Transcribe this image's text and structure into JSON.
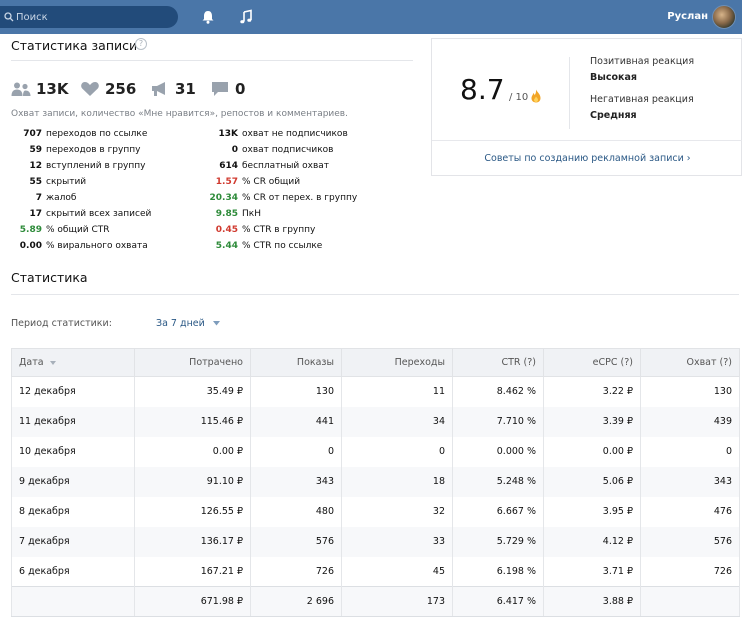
{
  "header": {
    "search_placeholder": "Поиск",
    "user_name": "Руслан"
  },
  "post_stats": {
    "title": "Статистика записи",
    "help": "?",
    "metrics": [
      {
        "icon": "users-icon",
        "value": "13K"
      },
      {
        "icon": "heart-icon",
        "value": "256"
      },
      {
        "icon": "megaphone-icon",
        "value": "31"
      },
      {
        "icon": "comment-icon",
        "value": "0"
      }
    ],
    "reach_note": "Охват записи, количество «Мне нравится», репостов и комментариев.",
    "left_stats": [
      {
        "value": "707",
        "label": "переходов по ссылке",
        "color": "normal"
      },
      {
        "value": "59",
        "label": "переходов в группу",
        "color": "normal"
      },
      {
        "value": "12",
        "label": "вступлений в группу",
        "color": "normal"
      },
      {
        "value": "55",
        "label": "скрытий",
        "color": "normal"
      },
      {
        "value": "7",
        "label": "жалоб",
        "color": "normal"
      },
      {
        "value": "17",
        "label": "скрытий всех записей",
        "color": "normal"
      },
      {
        "value": "5.89",
        "label": "% общий CTR",
        "color": "green"
      },
      {
        "value": "0.00",
        "label": "% вирального охвата",
        "color": "normal"
      }
    ],
    "right_stats": [
      {
        "value": "13K",
        "label": "охват не подписчиков",
        "color": "normal"
      },
      {
        "value": "0",
        "label": "охват подписчиков",
        "color": "normal"
      },
      {
        "value": "614",
        "label": "бесплатный охват",
        "color": "normal"
      },
      {
        "value": "1.57",
        "label": "% CR общий",
        "color": "red"
      },
      {
        "value": "20.34",
        "label": "% CR от перех. в группу",
        "color": "green"
      },
      {
        "value": "9.85",
        "label": "ПкН",
        "color": "green"
      },
      {
        "value": "0.45",
        "label": "% CTR в группу",
        "color": "red"
      },
      {
        "value": "5.44",
        "label": "% CTR по ссылке",
        "color": "green"
      }
    ]
  },
  "rating_card": {
    "score": "8.7",
    "score_denominator": "/ 10",
    "positive_label": "Позитивная реакция",
    "positive_value": "Высокая",
    "negative_label": "Негативная реакция",
    "negative_value": "Средняя",
    "advice_link": "Советы по созданию рекламной записи ›"
  },
  "statistics": {
    "title": "Статистика",
    "period_label": "Период статистики:",
    "period_value": "За 7 дней",
    "columns": [
      "Дата",
      "Потрачено",
      "Показы",
      "Переходы",
      "CTR (?)",
      "eCPC (?)",
      "Охват (?)"
    ],
    "rows": [
      {
        "date": "12 декабря",
        "spent": "35.49 ₽",
        "impressions": "130",
        "clicks": "11",
        "ctr": "8.462 %",
        "ecpc": "3.22 ₽",
        "reach": "130"
      },
      {
        "date": "11 декабря",
        "spent": "115.46 ₽",
        "impressions": "441",
        "clicks": "34",
        "ctr": "7.710 %",
        "ecpc": "3.39 ₽",
        "reach": "439"
      },
      {
        "date": "10 декабря",
        "spent": "0.00 ₽",
        "impressions": "0",
        "clicks": "0",
        "ctr": "0.000 %",
        "ecpc": "0.00 ₽",
        "reach": "0"
      },
      {
        "date": "9 декабря",
        "spent": "91.10 ₽",
        "impressions": "343",
        "clicks": "18",
        "ctr": "5.248 %",
        "ecpc": "5.06 ₽",
        "reach": "343"
      },
      {
        "date": "8 декабря",
        "spent": "126.55 ₽",
        "impressions": "480",
        "clicks": "32",
        "ctr": "6.667 %",
        "ecpc": "3.95 ₽",
        "reach": "476"
      },
      {
        "date": "7 декабря",
        "spent": "136.17 ₽",
        "impressions": "576",
        "clicks": "33",
        "ctr": "5.729 %",
        "ecpc": "4.12 ₽",
        "reach": "576"
      },
      {
        "date": "6 декабря",
        "spent": "167.21 ₽",
        "impressions": "726",
        "clicks": "45",
        "ctr": "6.198 %",
        "ecpc": "3.71 ₽",
        "reach": "726"
      }
    ],
    "total": {
      "date": "",
      "spent": "671.98 ₽",
      "impressions": "2 696",
      "clicks": "173",
      "ctr": "6.417 %",
      "ecpc": "3.88 ₽",
      "reach": ""
    }
  }
}
